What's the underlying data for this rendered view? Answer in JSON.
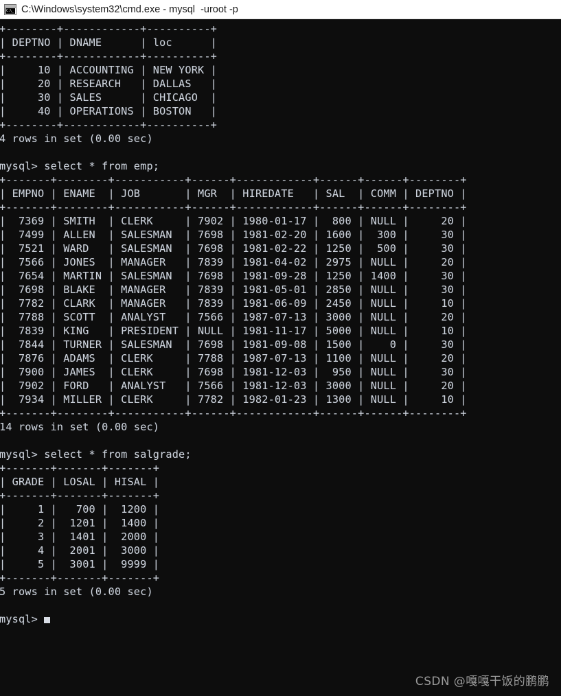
{
  "window": {
    "titlebar_text": "C:\\Windows\\system32\\cmd.exe - mysql  -uroot -p",
    "icon_name": "cmd-exe-icon",
    "icon_glyph": "C:\\_",
    "background_color": "#0d0d0d",
    "titlebar_background": "#ffffff",
    "text_color": "#cdd3dc"
  },
  "watermark": {
    "text": "CSDN @嘎嘎干饭的鹏鹏"
  },
  "terminal": {
    "prompt": "mysql>",
    "cursor": "block",
    "queries": [
      "select * from emp;",
      "select * from salgrade;"
    ],
    "dept_table": {
      "columns": [
        "DEPTNO",
        "DNAME",
        "loc"
      ],
      "rows": [
        [
          "10",
          "ACCOUNTING",
          "NEW YORK"
        ],
        [
          "20",
          "RESEARCH",
          "DALLAS"
        ],
        [
          "30",
          "SALES",
          "CHICAGO"
        ],
        [
          "40",
          "OPERATIONS",
          "BOSTON"
        ]
      ],
      "status": "4 rows in set (0.00 sec)"
    },
    "emp_table": {
      "columns": [
        "EMPNO",
        "ENAME",
        "JOB",
        "MGR",
        "HIREDATE",
        "SAL",
        "COMM",
        "DEPTNO"
      ],
      "rows": [
        [
          "7369",
          "SMITH",
          "CLERK",
          "7902",
          "1980-01-17",
          "800",
          "NULL",
          "20"
        ],
        [
          "7499",
          "ALLEN",
          "SALESMAN",
          "7698",
          "1981-02-20",
          "1600",
          "300",
          "30"
        ],
        [
          "7521",
          "WARD",
          "SALESMAN",
          "7698",
          "1981-02-22",
          "1250",
          "500",
          "30"
        ],
        [
          "7566",
          "JONES",
          "MANAGER",
          "7839",
          "1981-04-02",
          "2975",
          "NULL",
          "20"
        ],
        [
          "7654",
          "MARTIN",
          "SALESMAN",
          "7698",
          "1981-09-28",
          "1250",
          "1400",
          "30"
        ],
        [
          "7698",
          "BLAKE",
          "MANAGER",
          "7839",
          "1981-05-01",
          "2850",
          "NULL",
          "30"
        ],
        [
          "7782",
          "CLARK",
          "MANAGER",
          "7839",
          "1981-06-09",
          "2450",
          "NULL",
          "10"
        ],
        [
          "7788",
          "SCOTT",
          "ANALYST",
          "7566",
          "1987-07-13",
          "3000",
          "NULL",
          "20"
        ],
        [
          "7839",
          "KING",
          "PRESIDENT",
          "NULL",
          "1981-11-17",
          "5000",
          "NULL",
          "10"
        ],
        [
          "7844",
          "TURNER",
          "SALESMAN",
          "7698",
          "1981-09-08",
          "1500",
          "0",
          "30"
        ],
        [
          "7876",
          "ADAMS",
          "CLERK",
          "7788",
          "1987-07-13",
          "1100",
          "NULL",
          "20"
        ],
        [
          "7900",
          "JAMES",
          "CLERK",
          "7698",
          "1981-12-03",
          "950",
          "NULL",
          "30"
        ],
        [
          "7902",
          "FORD",
          "ANALYST",
          "7566",
          "1981-12-03",
          "3000",
          "NULL",
          "20"
        ],
        [
          "7934",
          "MILLER",
          "CLERK",
          "7782",
          "1982-01-23",
          "1300",
          "NULL",
          "10"
        ]
      ],
      "status": "14 rows in set (0.00 sec)"
    },
    "salgrade_table": {
      "columns": [
        "GRADE",
        "LOSAL",
        "HISAL"
      ],
      "rows": [
        [
          "1",
          "700",
          "1200"
        ],
        [
          "2",
          "1201",
          "1400"
        ],
        [
          "3",
          "1401",
          "2000"
        ],
        [
          "4",
          "2001",
          "3000"
        ],
        [
          "5",
          "3001",
          "9999"
        ]
      ],
      "status": "5 rows in set (0.00 sec)"
    },
    "screen_text": "+--------+------------+----------+\n| DEPTNO | DNAME      | loc      |\n+--------+------------+----------+\n|     10 | ACCOUNTING | NEW YORK |\n|     20 | RESEARCH   | DALLAS   |\n|     30 | SALES      | CHICAGO  |\n|     40 | OPERATIONS | BOSTON   |\n+--------+------------+----------+\n4 rows in set (0.00 sec)\n\nmysql> select * from emp;\n+-------+--------+-----------+------+------------+------+------+--------+\n| EMPNO | ENAME  | JOB       | MGR  | HIREDATE   | SAL  | COMM | DEPTNO |\n+-------+--------+-----------+------+------------+------+------+--------+\n|  7369 | SMITH  | CLERK     | 7902 | 1980-01-17 |  800 | NULL |     20 |\n|  7499 | ALLEN  | SALESMAN  | 7698 | 1981-02-20 | 1600 |  300 |     30 |\n|  7521 | WARD   | SALESMAN  | 7698 | 1981-02-22 | 1250 |  500 |     30 |\n|  7566 | JONES  | MANAGER   | 7839 | 1981-04-02 | 2975 | NULL |     20 |\n|  7654 | MARTIN | SALESMAN  | 7698 | 1981-09-28 | 1250 | 1400 |     30 |\n|  7698 | BLAKE  | MANAGER   | 7839 | 1981-05-01 | 2850 | NULL |     30 |\n|  7782 | CLARK  | MANAGER   | 7839 | 1981-06-09 | 2450 | NULL |     10 |\n|  7788 | SCOTT  | ANALYST   | 7566 | 1987-07-13 | 3000 | NULL |     20 |\n|  7839 | KING   | PRESIDENT | NULL | 1981-11-17 | 5000 | NULL |     10 |\n|  7844 | TURNER | SALESMAN  | 7698 | 1981-09-08 | 1500 |    0 |     30 |\n|  7876 | ADAMS  | CLERK     | 7788 | 1987-07-13 | 1100 | NULL |     20 |\n|  7900 | JAMES  | CLERK     | 7698 | 1981-12-03 |  950 | NULL |     30 |\n|  7902 | FORD   | ANALYST   | 7566 | 1981-12-03 | 3000 | NULL |     20 |\n|  7934 | MILLER | CLERK     | 7782 | 1982-01-23 | 1300 | NULL |     10 |\n+-------+--------+-----------+------+------------+------+------+--------+\n14 rows in set (0.00 sec)\n\nmysql> select * from salgrade;\n+-------+-------+-------+\n| GRADE | LOSAL | HISAL |\n+-------+-------+-------+\n|     1 |   700 |  1200 |\n|     2 |  1201 |  1400 |\n|     3 |  1401 |  2000 |\n|     4 |  2001 |  3000 |\n|     5 |  3001 |  9999 |\n+-------+-------+-------+\n5 rows in set (0.00 sec)\n\nmysql> "
  }
}
